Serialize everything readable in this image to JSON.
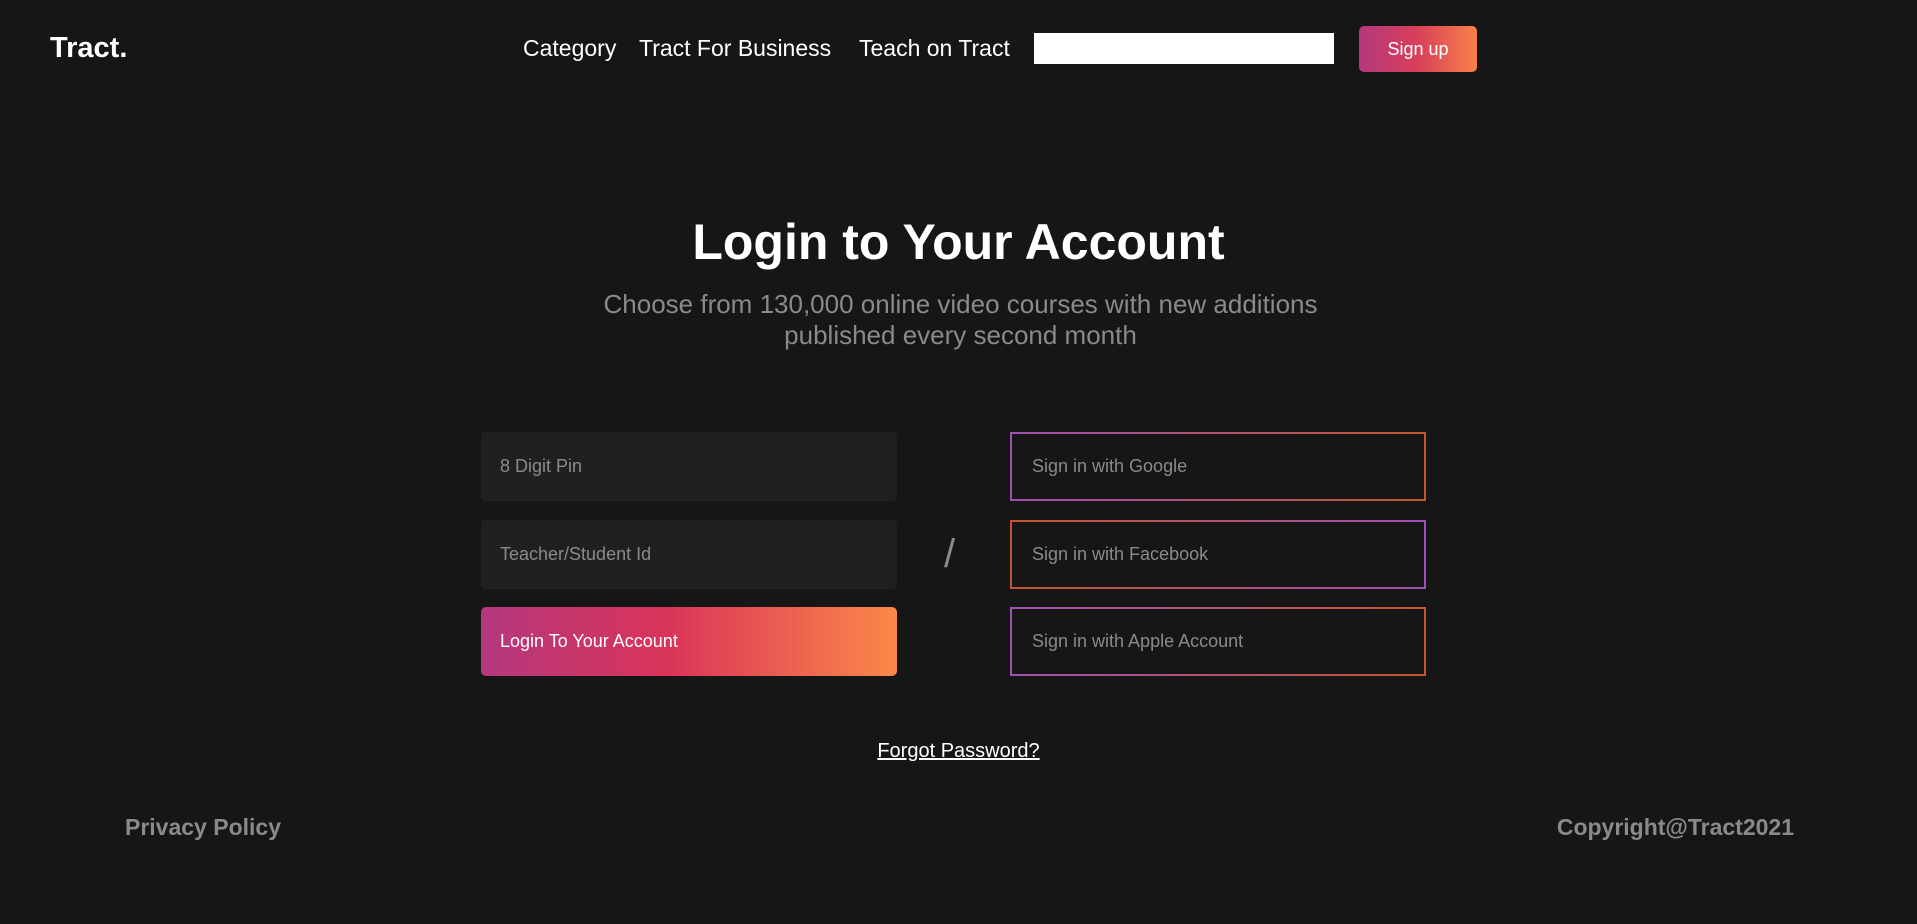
{
  "header": {
    "brand": "Tract.",
    "nav": [
      {
        "label": "Category"
      },
      {
        "label": "Tract For Business"
      },
      {
        "label": "Teach on Tract"
      }
    ],
    "search": {
      "value": "",
      "placeholder": ""
    },
    "signup_label": "Sign up"
  },
  "hero": {
    "title": "Login to Your Account",
    "subtitle": "Choose from 130,000 online video courses with new additions published every second month"
  },
  "login_form": {
    "pin_placeholder": "8 Digit Pin",
    "id_placeholder": "Teacher/Student Id",
    "submit_label": "Login To Your Account"
  },
  "divider": "/",
  "social": [
    {
      "label": "Sign in with Google"
    },
    {
      "label": "Sign in with Facebook"
    },
    {
      "label": "Sign in with Apple Account"
    }
  ],
  "forgot_password": "Forgot Password?",
  "footer": {
    "privacy": "Privacy Policy",
    "copyright": "Copyright@Tract2021"
  },
  "colors": {
    "background": "#161616",
    "field_background": "#202020",
    "gradient_start": "#b4377b",
    "gradient_mid": "#d8405a",
    "gradient_end": "#f88149",
    "muted_text": "#8a8a8a"
  }
}
